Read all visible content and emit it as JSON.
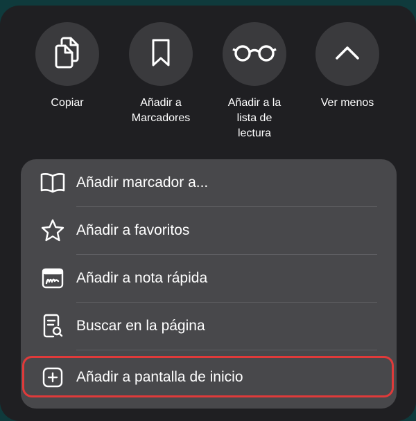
{
  "quick_actions": [
    {
      "label": "Copiar",
      "icon": "copy-icon"
    },
    {
      "label": "Añadir a\nMarcadores",
      "icon": "bookmark-icon"
    },
    {
      "label": "Añadir a la\nlista de\nlectura",
      "icon": "glasses-icon"
    },
    {
      "label": "Ver menos",
      "icon": "chevron-up-icon"
    }
  ],
  "menu_items": [
    {
      "label": "Añadir marcador a...",
      "icon": "book-icon"
    },
    {
      "label": "Añadir a favoritos",
      "icon": "star-icon"
    },
    {
      "label": "Añadir a nota rápida",
      "icon": "quick-note-icon"
    },
    {
      "label": "Buscar en la página",
      "icon": "find-in-page-icon"
    },
    {
      "label": "Añadir a pantalla de inicio",
      "icon": "add-square-icon",
      "highlighted": true
    }
  ],
  "colors": {
    "background": "#1f1f22",
    "menu_background": "#48484b",
    "highlight": "#e03a3a"
  }
}
